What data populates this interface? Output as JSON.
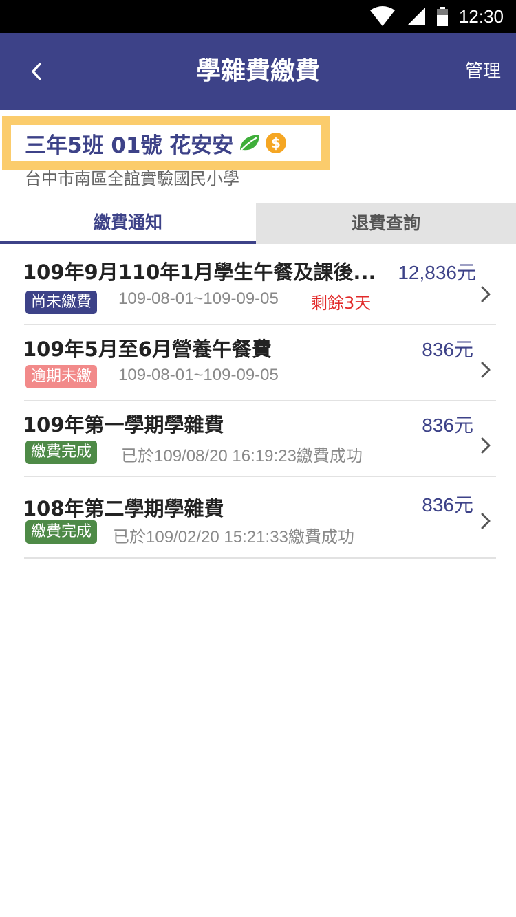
{
  "status_bar": {
    "time": "12:30",
    "icons": [
      "wifi-icon",
      "signal-icon",
      "battery-icon"
    ]
  },
  "header": {
    "title": "學雜費繳費",
    "manage_label": "管理",
    "back_icon": "chevron-left-icon"
  },
  "student": {
    "name": "三年5班 01號 花安安",
    "school": "台中市南區全誼實驗國民小學",
    "icons": [
      "leaf-icon",
      "coin-icon"
    ]
  },
  "tabs": [
    {
      "label": "繳費通知",
      "active": true
    },
    {
      "label": "退費查詢",
      "active": false
    }
  ],
  "bills": [
    {
      "title": "109年9月110年1月學生午餐及課後...",
      "amount": "12,836元",
      "status": "尚未繳費",
      "status_color": "#3d4288",
      "date": "109-08-01~109-09-05",
      "remaining": "剩餘3天"
    },
    {
      "title": "109年5月至6月營養午餐費",
      "amount": "836元",
      "status": "逾期未繳",
      "status_color": "#f28a8a",
      "date": "109-08-01~109-09-05",
      "remaining": ""
    },
    {
      "title": "109年第一學期學雜費",
      "amount": "836元",
      "status": "繳費完成",
      "status_color": "#4e8a47",
      "date": "已於109/08/20 16:19:23繳費成功",
      "remaining": ""
    },
    {
      "title": "108年第二學期學雜費",
      "amount": "836元",
      "status": "繳費完成",
      "status_color": "#4e8a47",
      "date": "已於109/02/20 15:21:33繳費成功",
      "remaining": ""
    }
  ],
  "colors": {
    "primary": "#3d4288",
    "highlight": "#fbcc6c",
    "warning": "#e22b2b",
    "leaf": "#3fae3a",
    "coin": "#f5a623"
  }
}
